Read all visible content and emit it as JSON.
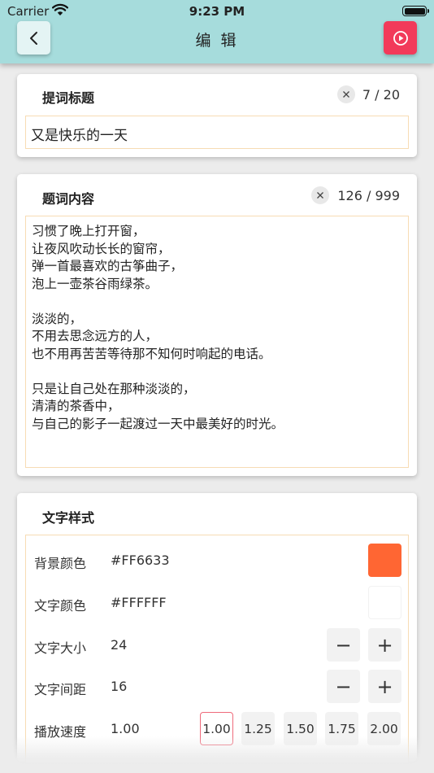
{
  "status_bar": {
    "carrier": "Carrier",
    "time": "9:23 PM"
  },
  "nav": {
    "title": "编 辑",
    "back_icon": "chevron-left-icon",
    "play_icon": "play-circle-icon"
  },
  "title_section": {
    "heading": "提词标题",
    "counter": "7 / 20",
    "value": "又是快乐的一天"
  },
  "content_section": {
    "heading": "题词内容",
    "counter": "126 / 999",
    "value": "习惯了晚上打开窗，\n让夜风吹动长长的窗帘，\n弹一首最喜欢的古筝曲子，\n泡上一壶茶谷雨绿茶。\n\n淡淡的，\n不用去思念远方的人，\n也不用再苦苦等待那不知何时响起的电话。\n\n只是让自己处在那种淡淡的，\n清清的茶香中，\n与自己的影子一起渡过一天中最美好的时光。"
  },
  "style_section": {
    "heading": "文字样式",
    "background_color": {
      "label": "背景颜色",
      "value": "#FF6633",
      "swatch": "#FF6633"
    },
    "text_color": {
      "label": "文字颜色",
      "value": "#FFFFFF",
      "swatch": "#FFFFFF"
    },
    "text_size": {
      "label": "文字大小",
      "value": "24",
      "minus": "−",
      "plus": "+"
    },
    "text_spacing": {
      "label": "文字间距",
      "value": "16",
      "minus": "−",
      "plus": "+"
    },
    "play_speed": {
      "label": "播放速度",
      "value": "1.00",
      "options": [
        "1.00",
        "1.25",
        "1.50",
        "1.75",
        "2.00"
      ],
      "selected": "1.00"
    }
  },
  "colors": {
    "nav_bg": "#A6DCDC",
    "play_button": "#F23A5A",
    "field_border": "#F7DCB4",
    "active_speed_border": "#EE6A7A"
  }
}
